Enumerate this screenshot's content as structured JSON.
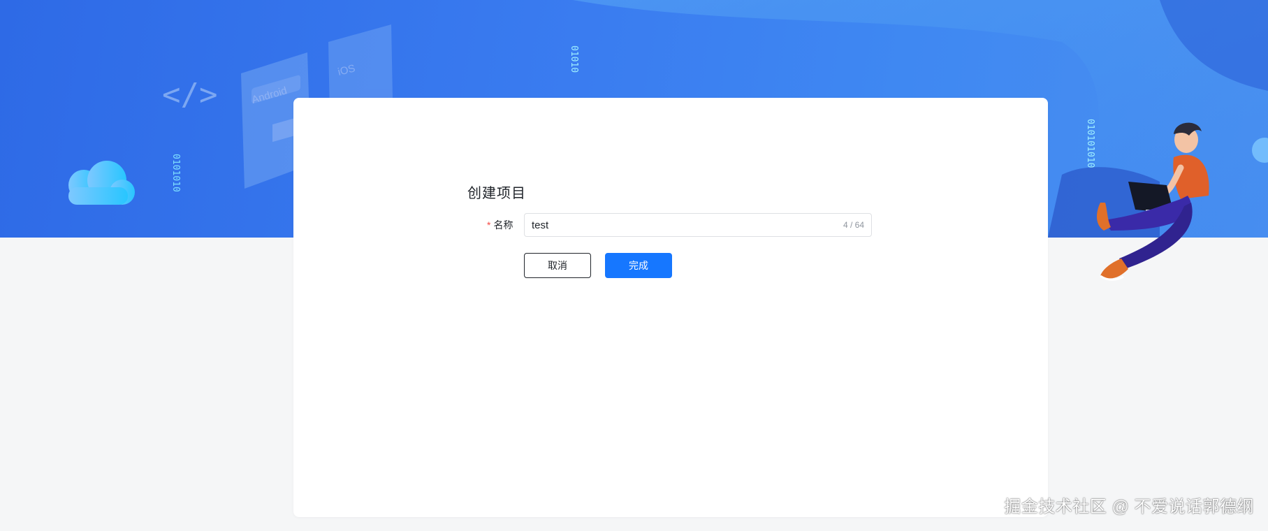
{
  "banner": {
    "android_label": "Android",
    "ios_label": "iOS",
    "code_glyph": "</>",
    "binary_strings": [
      "0101010",
      "01010",
      "010101010"
    ]
  },
  "form": {
    "title": "创建项目",
    "name_field": {
      "required_mark": "*",
      "label": "名称",
      "value": "test",
      "counter": "4 / 64"
    },
    "cancel_label": "取消",
    "submit_label": "完成"
  },
  "watermark": "掘金技术社区 @ 不爱说话郭德纲",
  "colors": {
    "banner_blue": "#2e6ae6",
    "primary": "#1677ff",
    "required": "#f54a45"
  }
}
